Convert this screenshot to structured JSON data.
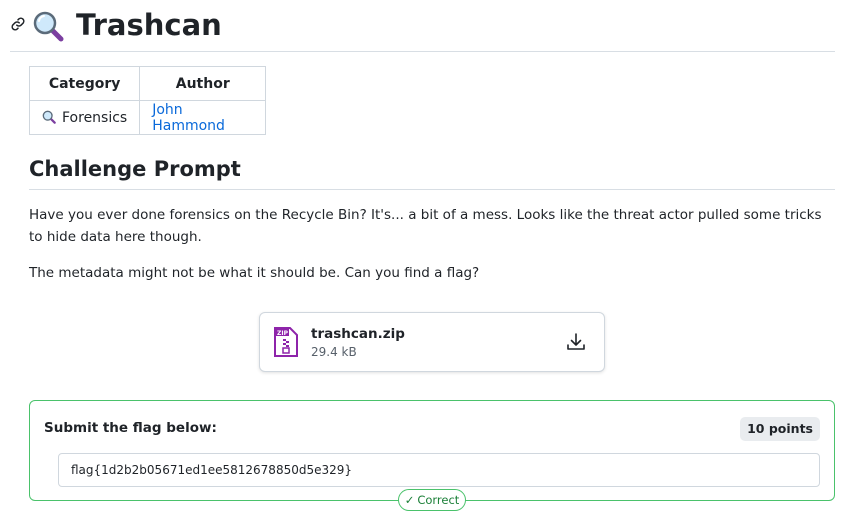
{
  "page": {
    "title": "Trashcan",
    "title_icon": "magnifying-glass-icon",
    "link_icon": "link-icon"
  },
  "meta_table": {
    "headers": [
      "Category",
      "Author"
    ],
    "category": "Forensics",
    "category_icon": "magnifying-glass-icon",
    "author": "John Hammond"
  },
  "prompt": {
    "heading": "Challenge Prompt",
    "paragraph1": "Have you ever done forensics on the Recycle Bin? It's... a bit of a mess. Looks like the threat actor pulled some tricks to hide data here though.",
    "paragraph2": "The metadata might not be what it should be. Can you find a flag?"
  },
  "attachment": {
    "name": "trashcan.zip",
    "size": "29.4 kB",
    "icon": "zip-file-icon",
    "action_icon": "download-icon"
  },
  "submission": {
    "label": "Submit the flag below:",
    "points": "10 points",
    "value": "flag{1d2b2b05671ed1ee5812678850d5e329}",
    "status": "Correct",
    "status_icon": "checkmark-icon"
  },
  "colors": {
    "accent_green": "#4ac26b",
    "link_blue": "#0969da",
    "zip_purple": "#8e24aa"
  }
}
